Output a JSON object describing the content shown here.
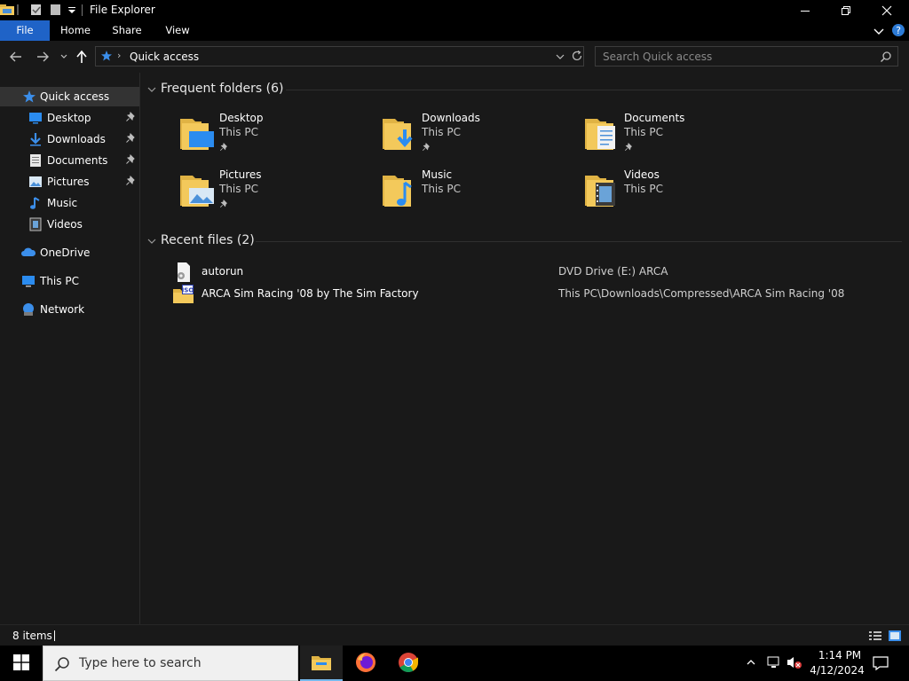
{
  "window": {
    "title": "File Explorer"
  },
  "ribbon": {
    "tabs": [
      "File",
      "Home",
      "Share",
      "View"
    ]
  },
  "address": {
    "path": "Quick access",
    "search_placeholder": "Search Quick access"
  },
  "navpane": {
    "items": [
      {
        "label": "Quick access",
        "icon": "star-icon",
        "pinned": false
      },
      {
        "label": "Desktop",
        "icon": "desktop-icon",
        "pinned": true
      },
      {
        "label": "Downloads",
        "icon": "download-arrow-icon",
        "pinned": true
      },
      {
        "label": "Documents",
        "icon": "document-icon",
        "pinned": true
      },
      {
        "label": "Pictures",
        "icon": "picture-icon",
        "pinned": true
      },
      {
        "label": "Music",
        "icon": "music-note-icon",
        "pinned": false
      },
      {
        "label": "Videos",
        "icon": "film-icon",
        "pinned": false
      },
      {
        "label": "OneDrive",
        "icon": "cloud-icon",
        "pinned": false
      },
      {
        "label": "This PC",
        "icon": "computer-icon",
        "pinned": false
      },
      {
        "label": "Network",
        "icon": "network-icon",
        "pinned": false
      }
    ]
  },
  "frequent": {
    "heading": "Frequent folders (6)",
    "folders": [
      {
        "name": "Desktop",
        "location": "This PC",
        "pinned": true
      },
      {
        "name": "Downloads",
        "location": "This PC",
        "pinned": true
      },
      {
        "name": "Documents",
        "location": "This PC",
        "pinned": true
      },
      {
        "name": "Pictures",
        "location": "This PC",
        "pinned": true
      },
      {
        "name": "Music",
        "location": "This PC",
        "pinned": false
      },
      {
        "name": "Videos",
        "location": "This PC",
        "pinned": false
      }
    ]
  },
  "recent": {
    "heading": "Recent files (2)",
    "files": [
      {
        "name": "autorun",
        "location": "DVD Drive (E:) ARCA",
        "icon": "settings-file-icon"
      },
      {
        "name": "ARCA Sim Racing '08 by The Sim Factory",
        "location": "This PC\\Downloads\\Compressed\\ARCA Sim Racing '08",
        "icon": "iso-file-icon"
      }
    ]
  },
  "status": {
    "item_count": "8 items"
  },
  "taskbar": {
    "search_placeholder": "Type here to search",
    "time": "1:14 PM",
    "date": "4/12/2024"
  },
  "colors": {
    "accent": "#1f63c7",
    "background": "#191919",
    "folder": "#f3c95b",
    "selection": "#333333"
  }
}
